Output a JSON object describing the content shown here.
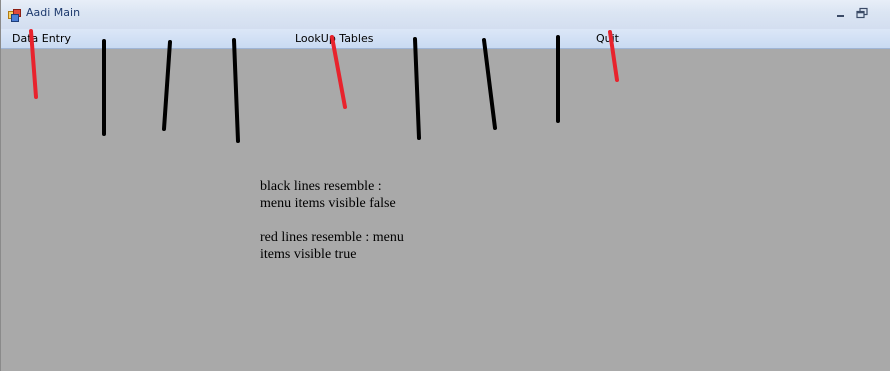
{
  "window": {
    "title": "Aadi Main",
    "icon": "app-form-icon",
    "controls": [
      "minimize-icon",
      "restore-icon"
    ]
  },
  "menu": {
    "items": [
      {
        "label": "Data Entry"
      },
      {
        "label": "LookUp Tables"
      },
      {
        "label": "Quit"
      }
    ]
  },
  "annotations": {
    "note1_line1": "black lines resemble :",
    "note1_line2": "menu items visible false",
    "note2_line1": "red lines resemble : menu",
    "note2_line2": "items visible true",
    "colors": {
      "red_line": "#e8232d",
      "black_line": "#000000"
    }
  },
  "colors": {
    "titlebar": "#dbe5f3",
    "menubar": "#c9daf2",
    "client_background": "#a9a9a9",
    "title_text": "#1e3a6e"
  }
}
